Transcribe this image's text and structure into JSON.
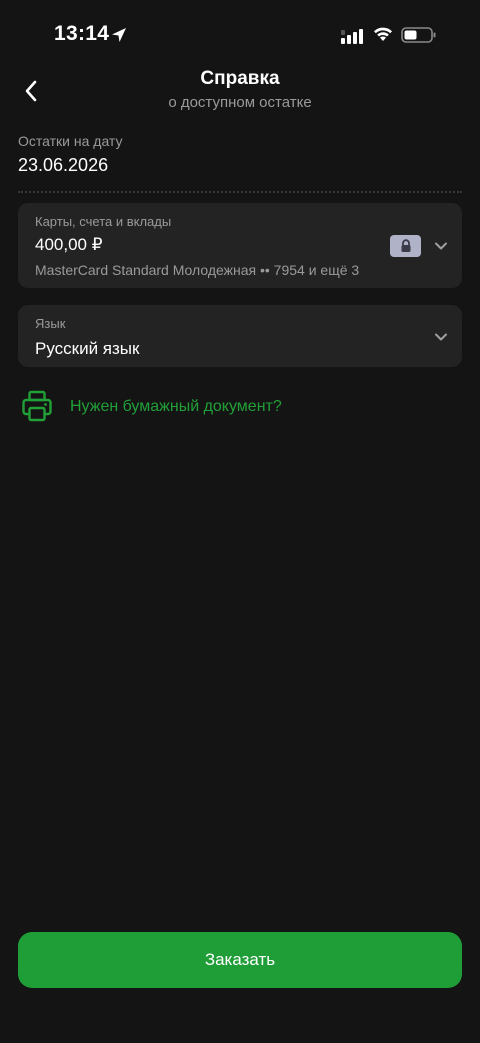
{
  "status_bar": {
    "time": "13:14",
    "icons": [
      "location-arrow-icon",
      "signal-icon",
      "wifi-icon",
      "battery-icon"
    ]
  },
  "header": {
    "title": "Справка",
    "subtitle": "о доступном остатке",
    "back_icon": "chevron-left-icon"
  },
  "date_section": {
    "label": "Остатки на дату",
    "value": "23.06.2026"
  },
  "accounts_card": {
    "label": "Карты, счета и вклады",
    "amount": "400,00 ₽",
    "details": "MasterCard Standard Молодежная •• 7954 и ещё 3",
    "icons": [
      "lock-icon",
      "chevron-down-icon"
    ]
  },
  "language_card": {
    "label": "Язык",
    "value": "Русский язык",
    "icons": [
      "chevron-down-icon"
    ]
  },
  "paper_link": {
    "text": "Нужен бумажный документ?",
    "icon": "printer-icon"
  },
  "order_button": {
    "label": "Заказать"
  },
  "colors": {
    "background": "#141414",
    "card": "#232323",
    "accent_green": "#21a038",
    "button_green": "#1f9e38",
    "secondary_text": "#9a9a9a",
    "lock_badge": "#b0b2c8"
  }
}
